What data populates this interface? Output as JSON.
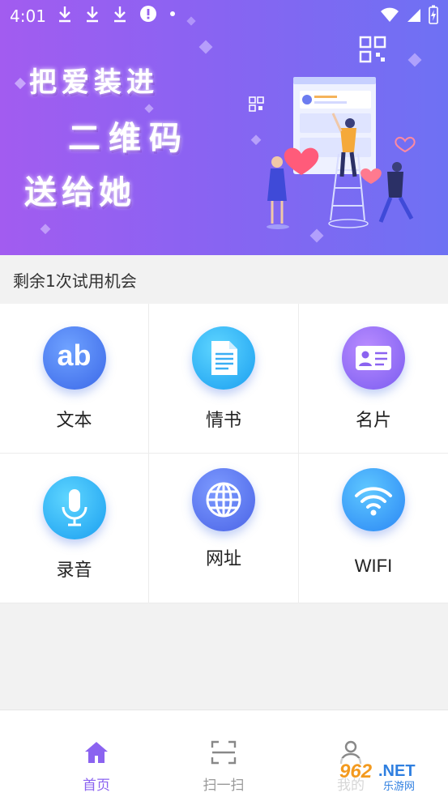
{
  "status_bar": {
    "time": "4:01"
  },
  "banner": {
    "slogan_line1": "把爱装进",
    "slogan_line2": "二维码",
    "slogan_line3": "送给她"
  },
  "trial": {
    "text": "剩余1次试用机会"
  },
  "grid": {
    "items": [
      {
        "label": "文本",
        "icon": "ab-text-icon",
        "icon_text": "ab"
      },
      {
        "label": "情书",
        "icon": "document-icon"
      },
      {
        "label": "名片",
        "icon": "id-card-icon"
      },
      {
        "label": "录音",
        "icon": "microphone-icon"
      },
      {
        "label": "网址",
        "icon": "globe-icon"
      },
      {
        "label": "WIFI",
        "icon": "wifi-icon"
      }
    ]
  },
  "bottom_nav": {
    "items": [
      {
        "label": "首页",
        "icon": "home-icon",
        "active": true
      },
      {
        "label": "扫一扫",
        "icon": "scan-icon",
        "active": false
      },
      {
        "label": "我的",
        "icon": "user-icon",
        "active": false
      }
    ]
  },
  "watermark": {
    "text": "962.NET",
    "subtext": "乐游网"
  },
  "colors": {
    "accent": "#8b63f0",
    "banner_start": "#a25cf0",
    "banner_end": "#6e71f3"
  }
}
